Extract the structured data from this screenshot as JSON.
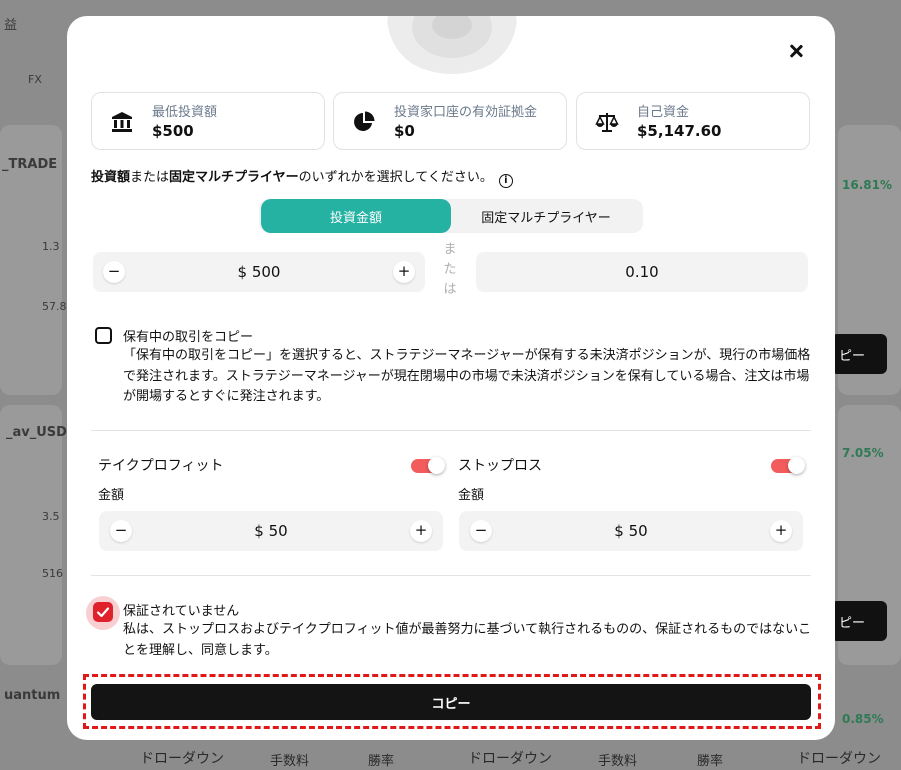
{
  "modal": {
    "stats": [
      {
        "icon": "bank-icon",
        "label": "最低投資額",
        "value": "$500"
      },
      {
        "icon": "pie-chart-icon",
        "label": "投資家口座の有効証拠金",
        "value": "$0"
      },
      {
        "icon": "scale-icon",
        "label": "自己資金",
        "value": "$5,147.60"
      }
    ],
    "instruction": {
      "part1": "投資額",
      "part2": "または",
      "part3": "固定マルチプライヤー",
      "part4": "のいずれかを選択してください。"
    },
    "mode_toggle": {
      "active_label": "投資金額",
      "inactive_label": "固定マルチプライヤー"
    },
    "investment_amount": "$ 500",
    "or_label": [
      "ま",
      "た",
      "は"
    ],
    "multiplier_value": "0.10",
    "copy_open_trades": {
      "title": "保有中の取引をコピー",
      "description": "「保有中の取引をコピー」を選択すると、ストラテジーマネージャーが保有する未決済ポジションが、現行の市場価格で発注されます。ストラテジーマネージャーが現在閉場中の市場で未決済ポジションを保有している場合、注文は市場が開場するとすぐに発注されます。",
      "checked": false
    },
    "take_profit": {
      "title": "テイクプロフィット",
      "amount_label": "金額",
      "value": "$ 50",
      "enabled": true
    },
    "stop_loss": {
      "title": "ストップロス",
      "amount_label": "金額",
      "value": "$ 50",
      "enabled": true
    },
    "not_guaranteed": {
      "title": "保証されていません",
      "description": "私は、ストップロスおよびテイクプロフィット値が最善努力に基づいて執行されるものの、保証されるものではないことを理解し、同意します。",
      "checked": true
    },
    "copy_button_label": "コピー",
    "colors": {
      "accent": "#26b2a3",
      "danger": "#e0202a",
      "button": "#141414",
      "highlight": "#e01818"
    }
  },
  "background": {
    "top_left": "益",
    "tab": "FX",
    "names": [
      "_TRADE",
      "_av_USD",
      "uantum"
    ],
    "values": [
      "1.3",
      "57.8",
      "3.5",
      "516"
    ],
    "right_pcts": [
      "16.81%",
      "7.05%",
      "0.85%"
    ],
    "right_button": "ピー",
    "bottom_labels": [
      "ドローダウン",
      "手数料",
      "勝率",
      "ドローダウン",
      "手数料",
      "勝率",
      "ドローダウン"
    ]
  }
}
